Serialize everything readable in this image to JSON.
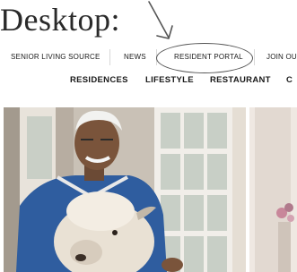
{
  "page": {
    "heading": "Desktop:"
  },
  "top_nav": {
    "items": [
      {
        "label": "SENIOR LIVING SOURCE"
      },
      {
        "label": "NEWS"
      },
      {
        "label": "RESIDENT PORTAL",
        "highlighted": true
      },
      {
        "label": "JOIN OU"
      }
    ]
  },
  "main_nav": {
    "items": [
      {
        "label": "RESIDENCES"
      },
      {
        "label": "LIFESTYLE"
      },
      {
        "label": "RESTAURANT"
      },
      {
        "label": "C"
      }
    ]
  },
  "hero": {
    "main_image": "photo-senior-man-with-alpaca",
    "side_image": "photo-interior-with-flowers"
  },
  "annotation": {
    "arrow_icon": "hand-drawn-arrow-icon",
    "circle_shape": "hand-drawn-ellipse",
    "color": "#555555"
  }
}
